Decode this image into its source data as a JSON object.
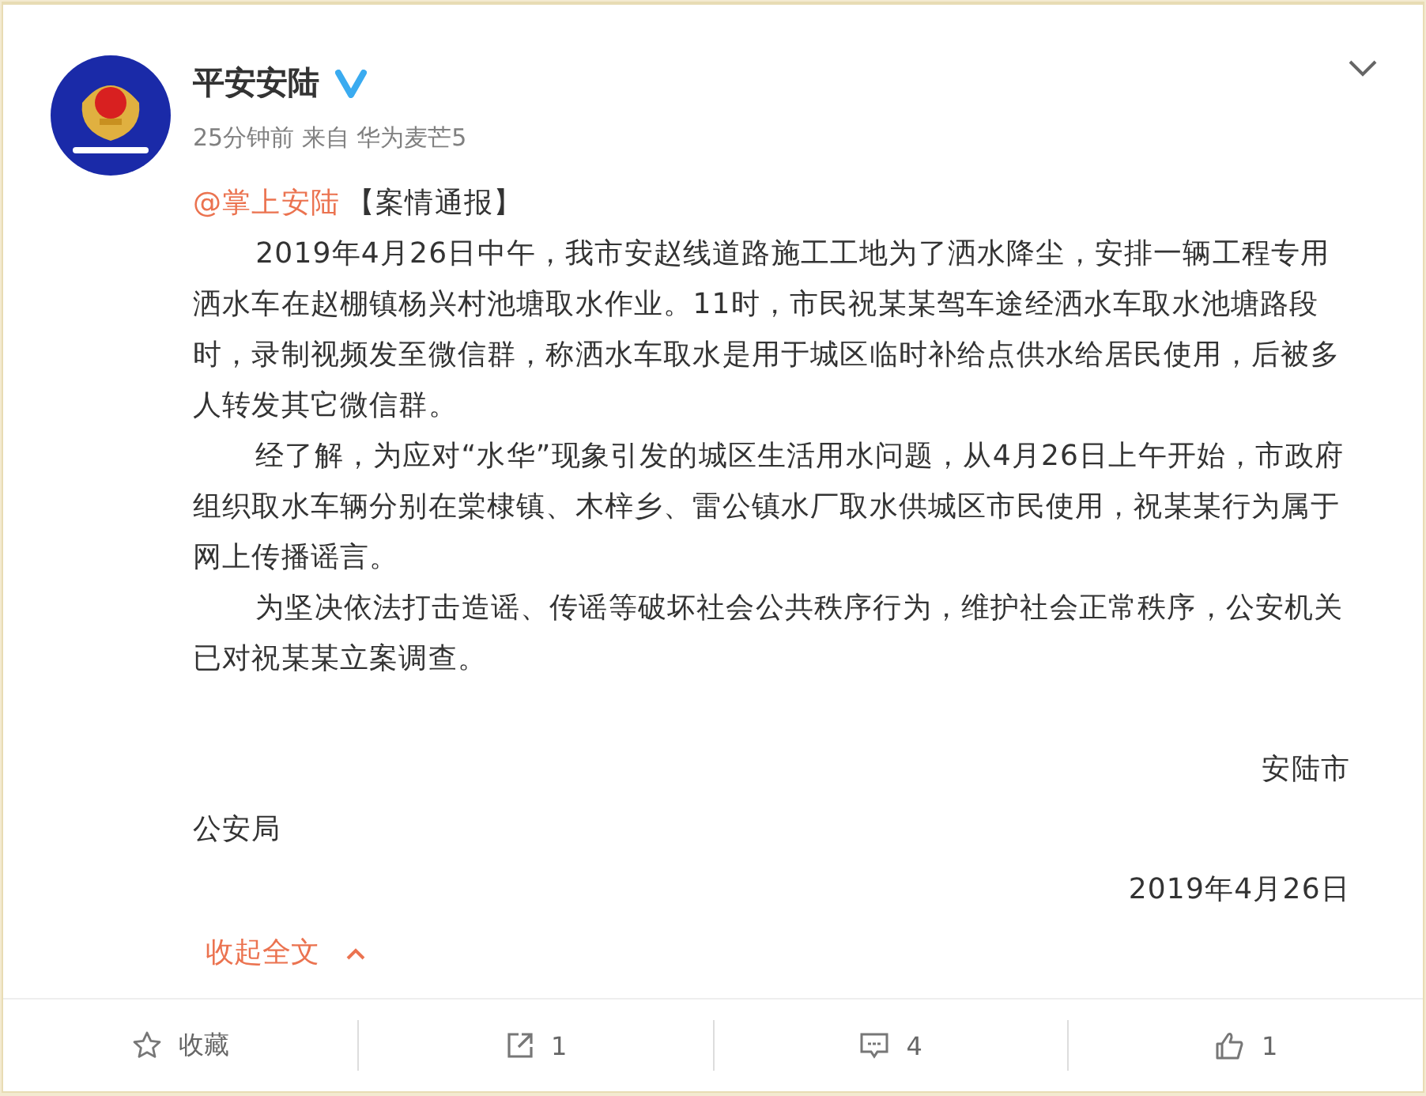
{
  "account": {
    "name": "平安安陆",
    "verified": true,
    "meta": "25分钟前 来自 华为麦芒5"
  },
  "post": {
    "mention": "@掌上安陆",
    "tag": "【案情通报】",
    "paragraphs": [
      "2019年4月26日中午，我市安赵线道路施工工地为了洒水降尘，安排一辆工程专用洒水车在赵棚镇杨兴村池塘取水作业。11时，市民祝某某驾车途经洒水车取水池塘路段时，录制视频发至微信群，称洒水车取水是用于城区临时补给点供水给居民使用，后被多人转发其它微信群。",
      "经了解，为应对“水华”现象引发的城区生活用水问题，从4月26日上午开始，市政府组织取水车辆分别在棠棣镇、木梓乡、雷公镇水厂取水供城区市民使用，祝某某行为属于网上传播谣言。",
      "为坚决依法打击造谣、传谣等破坏社会公共秩序行为，维护社会正常秩序，公安机关已对祝某某立案调查。"
    ],
    "signature": [
      {
        "text": "安陆市",
        "right_aligned": true
      },
      {
        "text": "公安局",
        "right_aligned": false
      },
      {
        "text": "2019年4月26日",
        "right_aligned": true
      }
    ],
    "collapse": "收起全文"
  },
  "actions": [
    {
      "kind": "favorite",
      "label": "收藏"
    },
    {
      "kind": "repost",
      "label": "1"
    },
    {
      "kind": "comment",
      "label": "4"
    },
    {
      "kind": "like",
      "label": "1"
    }
  ]
}
